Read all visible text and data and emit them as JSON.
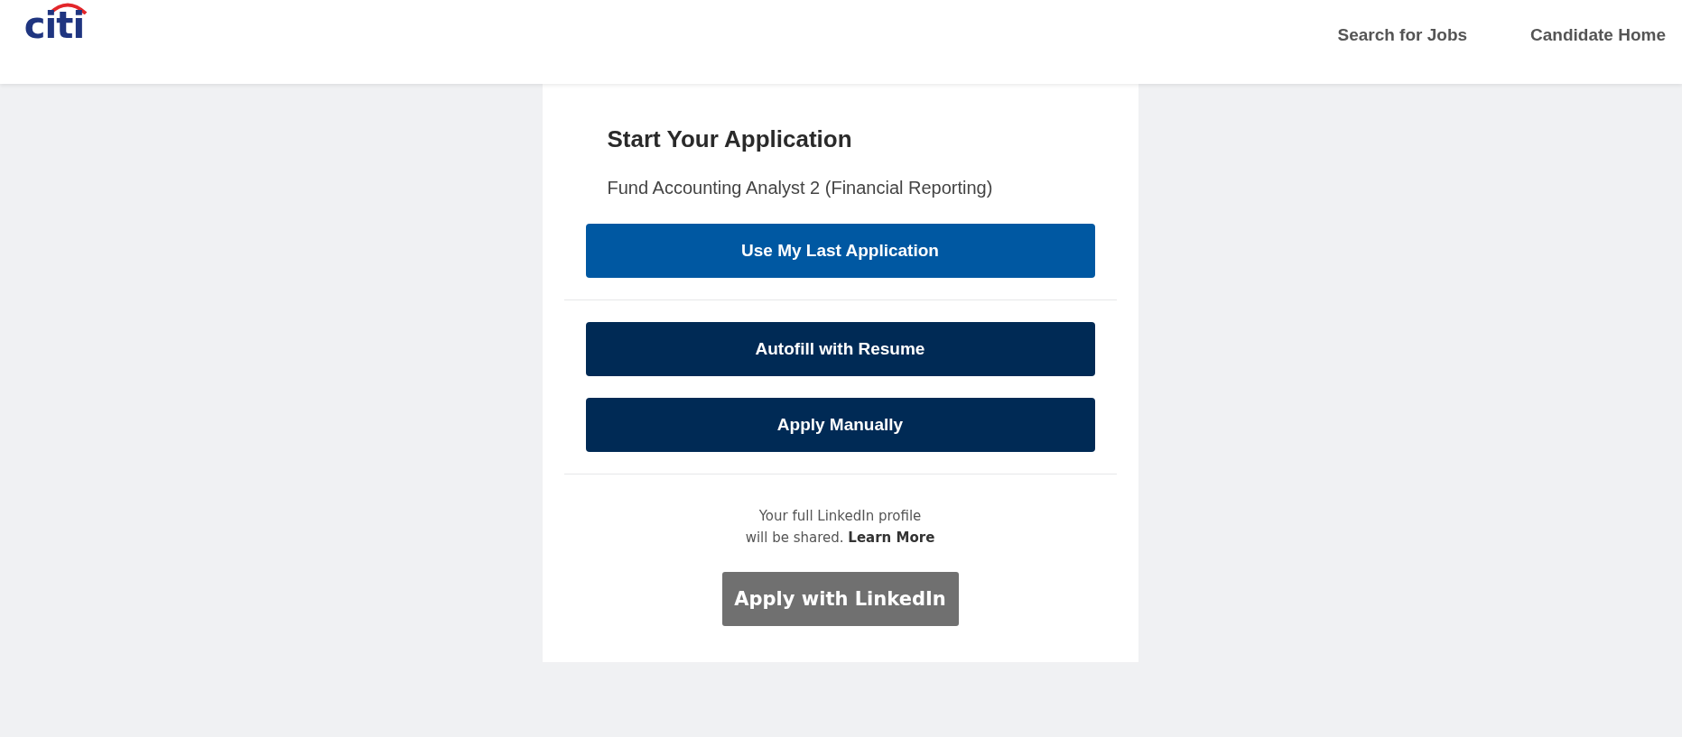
{
  "header": {
    "logo": "citi",
    "nav": [
      {
        "label": "Search for Jobs"
      },
      {
        "label": "Candidate Home"
      }
    ]
  },
  "card": {
    "title": "Start Your Application",
    "job": "Fund Accounting Analyst 2 (Financial Reporting)",
    "button_groups": [
      [
        {
          "label": "Use My Last Application",
          "kind": "primary"
        }
      ],
      [
        {
          "label": "Autofill with Resume",
          "kind": "secondary"
        },
        {
          "label": "Apply Manually",
          "kind": "secondary"
        }
      ]
    ],
    "linkedin": {
      "note_line_1": "Your full LinkedIn profile",
      "note_line_2": "will be shared.",
      "link": "Learn More",
      "button": "Apply with LinkedIn"
    }
  }
}
